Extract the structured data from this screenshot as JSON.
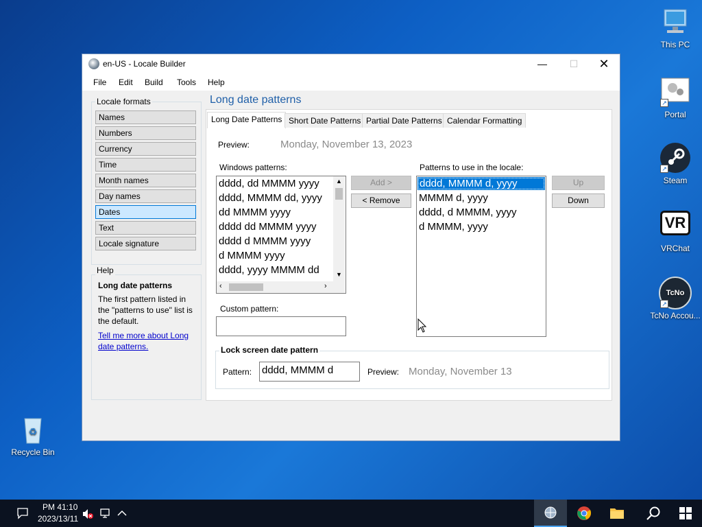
{
  "desktop": {
    "icons": [
      {
        "label": "This PC",
        "icon": "computer-icon"
      },
      {
        "label": "Portal",
        "icon": "portal-icon"
      },
      {
        "label": "Steam",
        "icon": "steam-icon"
      },
      {
        "label": "VRChat",
        "icon": "vrchat-icon"
      },
      {
        "label": "TcNo Accou...",
        "icon": "tcno-icon"
      },
      {
        "label": "Recycle Bin",
        "icon": "recycle-bin-icon"
      }
    ],
    "vr_text": "VR",
    "tcno_text": "TcNo"
  },
  "window": {
    "title": "en-US - Locale Builder",
    "menu": [
      "File",
      "Edit",
      "Build",
      "Tools",
      "Help"
    ],
    "sidebar": {
      "group_title": "Locale formats",
      "items": [
        "Names",
        "Numbers",
        "Currency",
        "Time",
        "Month names",
        "Day names",
        "Dates",
        "Text",
        "Locale signature"
      ],
      "selected": "Dates"
    },
    "help": {
      "group_title": "Help",
      "heading": "Long date patterns",
      "body": "The first pattern listed in the \"patterns to use\" list is the default.",
      "link": "Tell me more about Long date patterns."
    },
    "section_title": "Long date patterns",
    "tabs": [
      "Long Date Patterns",
      "Short Date Patterns",
      "Partial Date Patterns",
      "Calendar Formatting"
    ],
    "active_tab": "Long Date Patterns",
    "preview_label": "Preview:",
    "preview_value": "Monday, November 13, 2023",
    "windows_patterns": {
      "label": "Windows patterns:",
      "items": [
        "dddd, dd MMMM yyyy",
        "dddd, MMMM dd, yyyy",
        "dd MMMM yyyy",
        "dddd dd MMMM yyyy",
        "dddd d MMMM yyyy",
        "d MMMM yyyy",
        "dddd, yyyy MMMM dd"
      ]
    },
    "buttons": {
      "add": "Add >",
      "remove": "< Remove",
      "up": "Up",
      "down": "Down"
    },
    "locale_patterns": {
      "label": "Patterns to use in the locale:",
      "items": [
        "dddd, MMMM d, yyyy",
        "MMMM d, yyyy",
        "dddd, d MMMM, yyyy",
        "d MMMM, yyyy"
      ],
      "selected_index": 0
    },
    "custom_pattern": {
      "label": "Custom pattern:",
      "value": ""
    },
    "lock_screen": {
      "group_title": "Lock screen date pattern",
      "pattern_label": "Pattern:",
      "pattern_value": "dddd, MMMM d",
      "preview_label": "Preview:",
      "preview_value": "Monday, November 13"
    }
  },
  "taskbar": {
    "time": "PM 41:10",
    "date": "2023/13/11"
  }
}
